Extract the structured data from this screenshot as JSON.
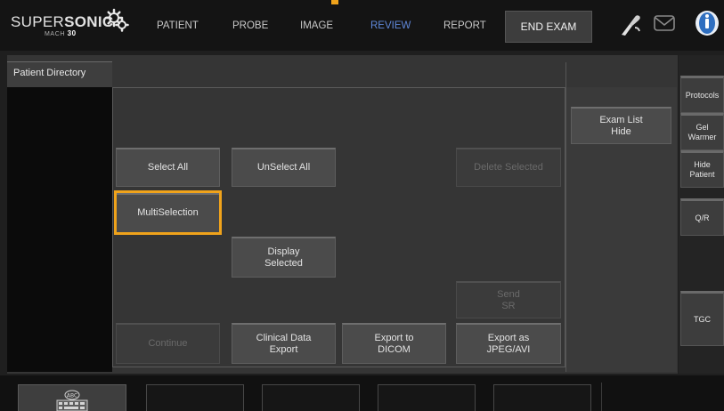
{
  "brand": {
    "name_prefix": "SUPER",
    "name_bold": "SONIC",
    "model_prefix": "MACH",
    "model_number": "30"
  },
  "topnav": {
    "items": [
      {
        "label": "PATIENT",
        "active": false
      },
      {
        "label": "PROBE",
        "active": false
      },
      {
        "label": "IMAGE",
        "active": false
      },
      {
        "label": "REVIEW",
        "active": true
      },
      {
        "label": "REPORT",
        "active": false
      }
    ],
    "end_exam_label": "END EXAM",
    "icons": [
      "probe-icon",
      "mail-icon",
      "help-icon"
    ]
  },
  "panel": {
    "title": "Patient Directory"
  },
  "buttons": {
    "select_all": "Select All",
    "unselect_all": "UnSelect All",
    "delete_selected": "Delete Selected",
    "multi_selection": "MultiSelection",
    "display_selected": "Display\nSelected",
    "send_sr": "Send\nSR",
    "continue": "Continue",
    "clinical_data_export": "Clinical Data\nExport",
    "export_to_dicom": "Export to\nDICOM",
    "export_as_jpeg_avi": "Export as\nJPEG/AVI",
    "exam_list_hide": "Exam List\nHide"
  },
  "side": {
    "protocols": "Protocols",
    "gel_warmer": "Gel\nWarmer",
    "hide_patient": "Hide\nPatient",
    "qr": "Q/R",
    "tgc": "TGC"
  },
  "bottom": {
    "keyboard_badge": "ABC"
  },
  "colors": {
    "highlight": "#f0a31b",
    "active_nav": "#5f87d9"
  }
}
